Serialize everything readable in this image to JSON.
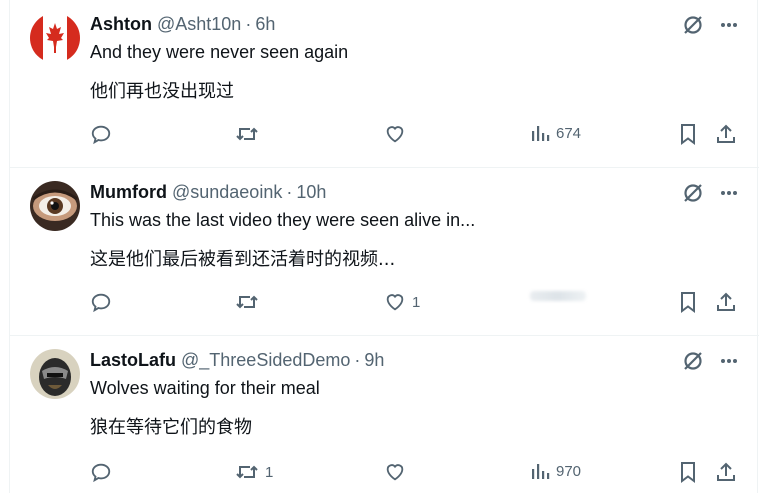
{
  "replies": [
    {
      "name": "Ashton",
      "handle": "@Asht10n",
      "time": "6h",
      "text": "And they were never seen again",
      "translation": "他们再也没出现过",
      "avatar": "canada-flag-avatar",
      "replies_count": "",
      "reposts_count": "",
      "likes_count": "",
      "views_count": "674"
    },
    {
      "name": "Mumford",
      "handle": "@sundaeoink",
      "time": "10h",
      "text": "This was the last video they were seen alive in...",
      "translation": "这是他们最后被看到还活着时的视频...",
      "avatar": "eye-closeup-avatar",
      "replies_count": "",
      "reposts_count": "",
      "likes_count": "1",
      "views_count": ""
    },
    {
      "name": "LastoLafu",
      "handle": "@_ThreeSidedDemo",
      "time": "9h",
      "text": "Wolves waiting for their meal",
      "translation": "狼在等待它们的食物",
      "avatar": "helmet-avatar",
      "replies_count": "",
      "reposts_count": "1",
      "likes_count": "",
      "views_count": "970"
    }
  ],
  "colors": {
    "text": "#0f1419",
    "secondary": "#536471",
    "border": "#eff3f4"
  },
  "icons": [
    "grok-icon",
    "more-icon",
    "reply-icon",
    "repost-icon",
    "like-icon",
    "views-icon",
    "bookmark-icon",
    "share-icon"
  ],
  "separator": "·"
}
